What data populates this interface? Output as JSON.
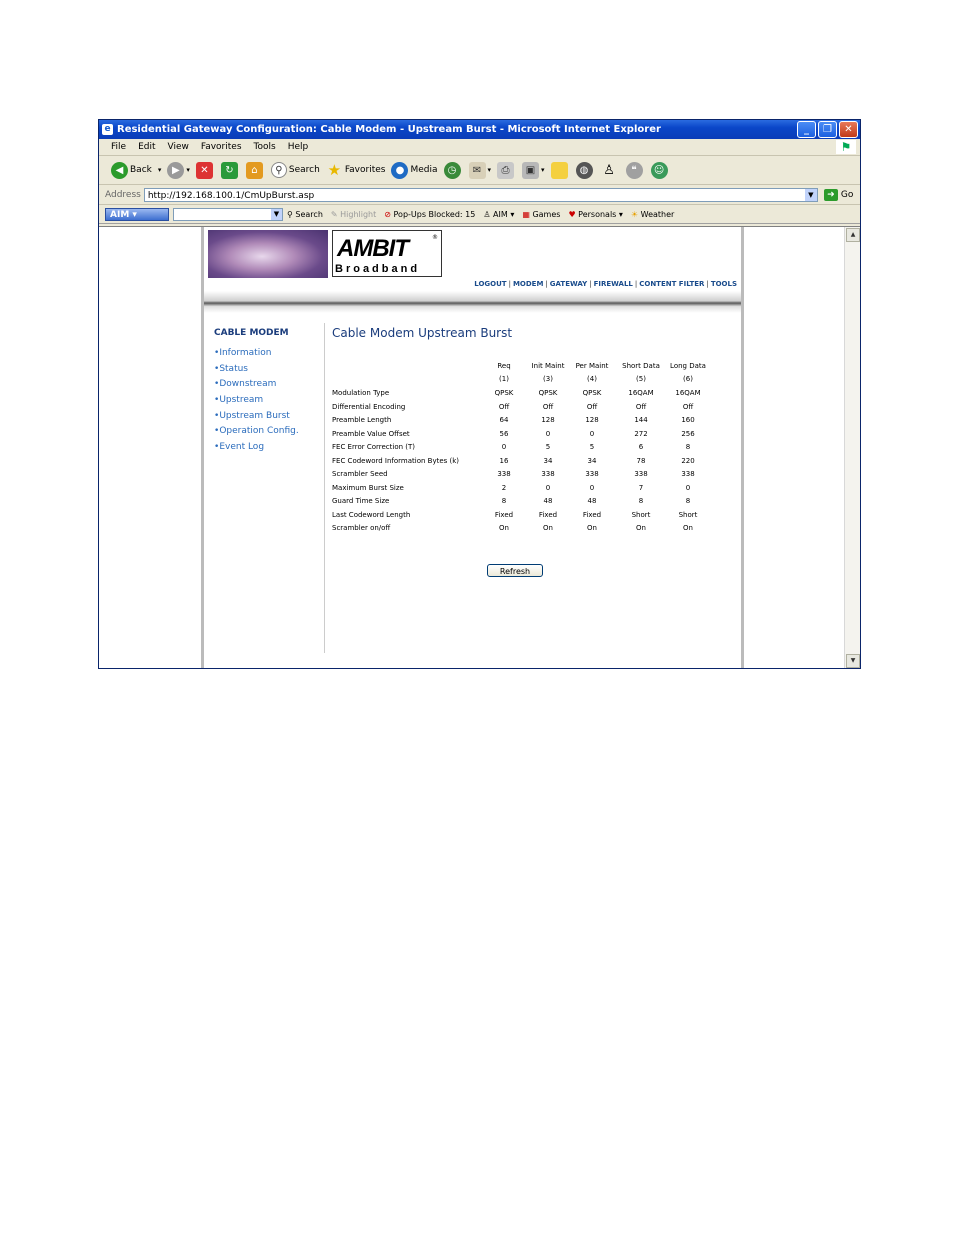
{
  "window": {
    "title": "Residential Gateway Configuration: Cable Modem - Upstream Burst - Microsoft Internet Explorer"
  },
  "menu": [
    "File",
    "Edit",
    "View",
    "Favorites",
    "Tools",
    "Help"
  ],
  "toolbar": {
    "back": "Back",
    "search": "Search",
    "favorites": "Favorites",
    "media": "Media"
  },
  "address": {
    "label": "Address",
    "url": "http://192.168.100.1/CmUpBurst.asp",
    "go": "Go"
  },
  "aim": {
    "button": "AIM",
    "search": "Search",
    "highlight": "Highlight",
    "popups": "Pop-Ups Blocked: 15",
    "aim": "AIM",
    "games": "Games",
    "personals": "Personals",
    "weather": "Weather"
  },
  "logo": {
    "main": "AMBIT",
    "sub": "Broadband"
  },
  "topnav": [
    "LOGOUT",
    "MODEM",
    "GATEWAY",
    "FIREWALL",
    "CONTENT FILTER",
    "TOOLS"
  ],
  "sidebar": {
    "title": "CABLE MODEM",
    "items": [
      "Information",
      "Status",
      "Downstream",
      "Upstream",
      "Upstream Burst",
      "Operation Config.",
      "Event Log"
    ]
  },
  "main": {
    "title": "Cable Modem Upstream Burst",
    "headers": [
      "Req",
      "Init Maint",
      "Per Maint",
      "Short Data",
      "Long Data"
    ],
    "subheaders": [
      "(1)",
      "(3)",
      "(4)",
      "(5)",
      "(6)"
    ],
    "rows": [
      {
        "label": "Modulation Type",
        "values": [
          "QPSK",
          "QPSK",
          "QPSK",
          "16QAM",
          "16QAM"
        ]
      },
      {
        "label": "Differential Encoding",
        "values": [
          "Off",
          "Off",
          "Off",
          "Off",
          "Off"
        ]
      },
      {
        "label": "Preamble Length",
        "values": [
          "64",
          "128",
          "128",
          "144",
          "160"
        ]
      },
      {
        "label": "Preamble Value Offset",
        "values": [
          "56",
          "0",
          "0",
          "272",
          "256"
        ]
      },
      {
        "label": "FEC Error Correction (T)",
        "values": [
          "0",
          "5",
          "5",
          "6",
          "8"
        ]
      },
      {
        "label": "FEC Codeword Information Bytes (k)",
        "values": [
          "16",
          "34",
          "34",
          "78",
          "220"
        ]
      },
      {
        "label": "Scrambler Seed",
        "values": [
          "338",
          "338",
          "338",
          "338",
          "338"
        ]
      },
      {
        "label": "Maximum Burst Size",
        "values": [
          "2",
          "0",
          "0",
          "7",
          "0"
        ]
      },
      {
        "label": "Guard Time Size",
        "values": [
          "8",
          "48",
          "48",
          "8",
          "8"
        ]
      },
      {
        "label": "Last Codeword Length",
        "values": [
          "Fixed",
          "Fixed",
          "Fixed",
          "Short",
          "Short"
        ]
      },
      {
        "label": "Scrambler on/off",
        "values": [
          "On",
          "On",
          "On",
          "On",
          "On"
        ]
      }
    ],
    "refresh": "Refresh"
  }
}
